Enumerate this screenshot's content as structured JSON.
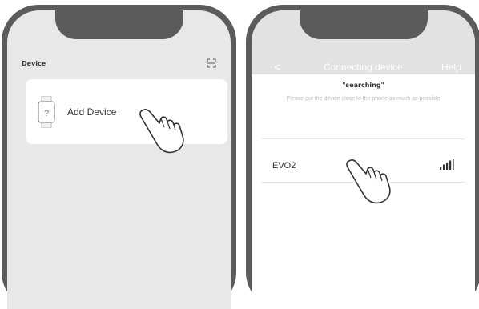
{
  "left_phone": {
    "header": "Device",
    "add_device_label": "Add  Device",
    "icons": {
      "scan": "scan-icon",
      "watch": "watch-icon",
      "hand": "pointing-hand-icon"
    }
  },
  "right_phone": {
    "back_label": "<",
    "title": "Connecting device",
    "help_label": "Help",
    "status": "\"searching\"",
    "hint": "Please put the device close to the phone as much as possible",
    "devices": [
      {
        "name": "EVO2",
        "signal_icon": "signal-icon"
      }
    ],
    "icons": {
      "hand": "pointing-hand-icon"
    }
  }
}
